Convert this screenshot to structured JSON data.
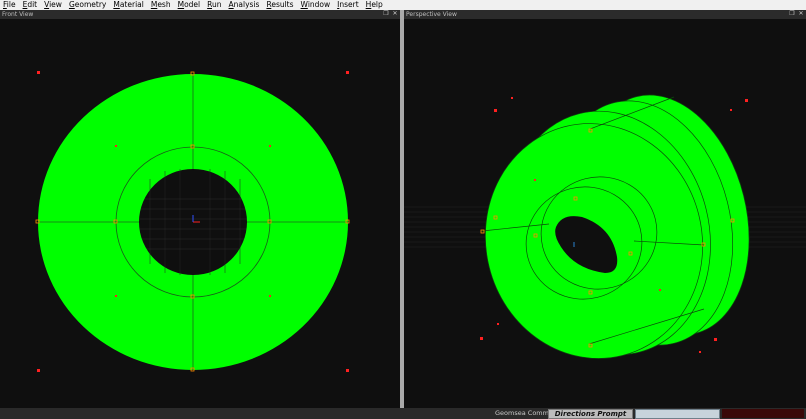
{
  "menu": [
    "File",
    "Edit",
    "View",
    "Geometry",
    "Material",
    "Mesh",
    "Model",
    "Run",
    "Analysis",
    "Results",
    "Window",
    "Insert",
    "Help"
  ],
  "front_view": {
    "title": "Front View"
  },
  "perspective_view": {
    "title": "Perspective View"
  },
  "status_bar": {
    "command_label": "Geomsea Command:",
    "prompt_text": "Directions Prompt",
    "command_value": ""
  },
  "icons": {
    "restore": "restore-icon",
    "close": "close-icon"
  },
  "colors": {
    "geometry_fill": "#00ff00",
    "viewport_bg": "#0f0f0f",
    "handle": "#ff7f00",
    "point": "#ff2020"
  }
}
